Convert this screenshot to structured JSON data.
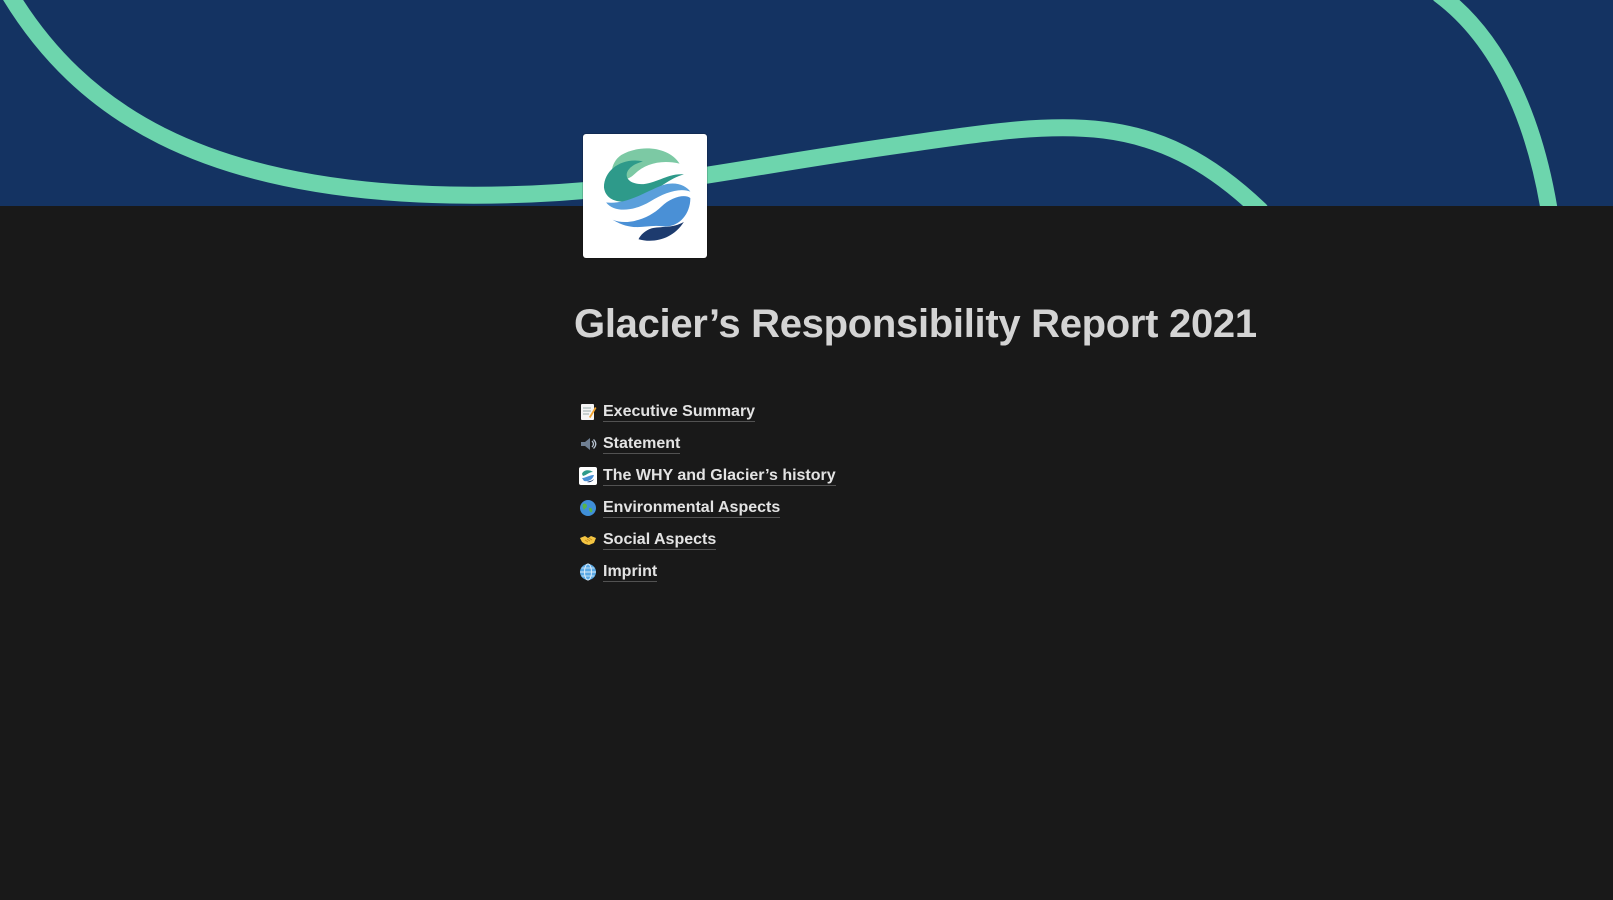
{
  "page": {
    "title": "Glacier’s Responsibility Report 2021"
  },
  "cover": {
    "background_color": "#143362",
    "wave_color": "#6dd5ad"
  },
  "page_icon": {
    "name": "glacier-logo-icon"
  },
  "links": [
    {
      "icon": "memo-icon",
      "label": "Executive Summary"
    },
    {
      "icon": "speaker-icon",
      "label": "Statement"
    },
    {
      "icon": "glacier-logo-icon",
      "label": "The WHY and Glacier’s history"
    },
    {
      "icon": "earth-icon",
      "label": "Environmental Aspects"
    },
    {
      "icon": "handshake-icon",
      "label": "Social Aspects"
    },
    {
      "icon": "globe-icon",
      "label": "Imprint"
    }
  ]
}
